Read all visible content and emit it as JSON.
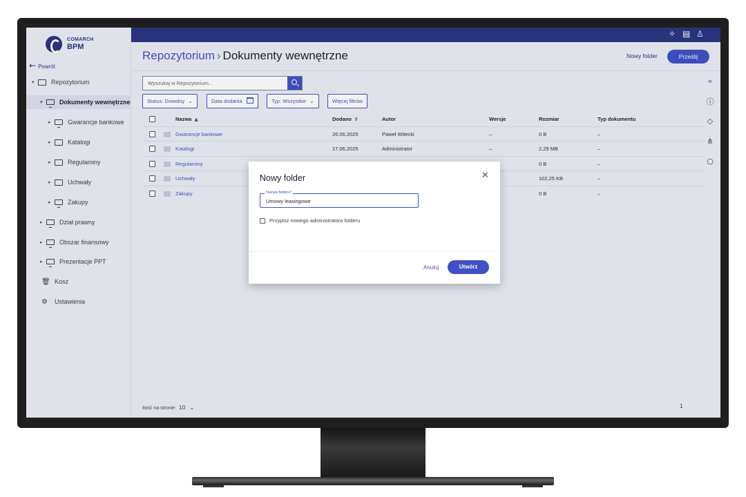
{
  "logo": {
    "brand": "COMARCH",
    "product": "BPM"
  },
  "sidebar": {
    "back_label": "Powrót",
    "items": [
      {
        "label": "Repozytorium"
      },
      {
        "label": "Dokumenty wewnętrzne"
      },
      {
        "label": "Gwarancje bankowe"
      },
      {
        "label": "Katalogi"
      },
      {
        "label": "Regulaminy"
      },
      {
        "label": "Uchwały"
      },
      {
        "label": "Zakupy"
      },
      {
        "label": "Dział prawny"
      },
      {
        "label": "Obszar finansowy"
      },
      {
        "label": "Prezentacje PPT"
      },
      {
        "label": "Kosz"
      },
      {
        "label": "Ustawienia"
      }
    ]
  },
  "header": {
    "breadcrumb_root": "Repozytorium",
    "separator": "›",
    "current": "Dokumenty wewnętrzne",
    "new_folder_label": "Nowy folder",
    "upload_label": "Prześlij"
  },
  "search": {
    "placeholder": "Wyszukaj w Repozytorium..."
  },
  "filters": {
    "status": "Status: Dowolny",
    "date": "Data dodania",
    "type": "Typ: Wszystkie",
    "more": "Więcej filtrów"
  },
  "table": {
    "columns": [
      "Nazwa",
      "Dodano",
      "Autor",
      "Wersje",
      "Rozmiar",
      "Typ dokumentu"
    ],
    "rows": [
      {
        "name": "Gwarancje bankowe",
        "added": "26.06.2025",
        "author": "Paweł Witecki",
        "versions": "–",
        "size": "0 B",
        "type": "–"
      },
      {
        "name": "Katalogi",
        "added": "17.06.2025",
        "author": "Administrator",
        "versions": "–",
        "size": "2,29 MB",
        "type": "–"
      },
      {
        "name": "Regulaminy",
        "added": "",
        "author": "",
        "versions": "",
        "size": "0 B",
        "type": "–"
      },
      {
        "name": "Uchwały",
        "added": "",
        "author": "",
        "versions": "",
        "size": "102,25 KB",
        "type": "–"
      },
      {
        "name": "Zakupy",
        "added": "",
        "author": "",
        "versions": "",
        "size": "0 B",
        "type": "–"
      }
    ]
  },
  "pagination": {
    "per_page_label": "Ilość na stronie:",
    "per_page": "10",
    "page": "1"
  },
  "modal": {
    "title": "Nowy folder",
    "field_label": "Nazwa folderu*",
    "field_value": "Umowy leasingowe",
    "checkbox_label": "Przypisz nowego administratora folderu",
    "cancel_label": "Anuluj",
    "create_label": "Utwórz"
  },
  "colors": {
    "accent": "#3f51c5",
    "topbar": "#2a3580",
    "background": "#eceef6"
  }
}
